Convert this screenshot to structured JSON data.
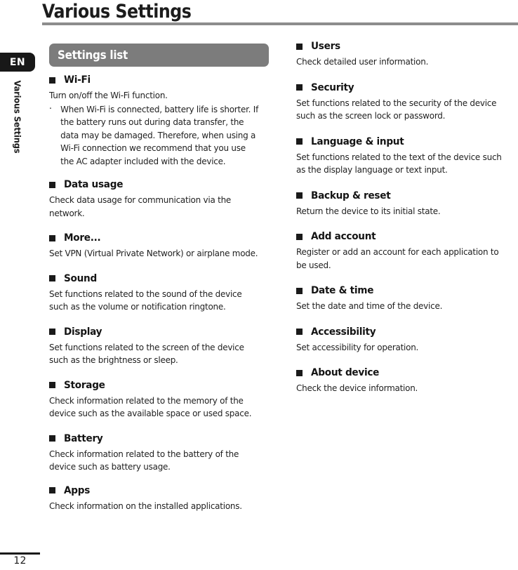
{
  "page": {
    "title": "Various Settings",
    "number": "12",
    "language_tab": "EN",
    "vertical_label": "Various Settings"
  },
  "banner": {
    "label": "Settings list"
  },
  "left_column": [
    {
      "title": "Wi-Fi",
      "body": "Turn on/off the Wi-Fi function.",
      "notes": [
        {
          "dot": "·",
          "text": "When Wi-Fi is connected, battery life is shorter. If the battery runs out during data transfer, the data may be damaged. Therefore, when using a Wi-Fi connection we recommend that you use the AC adapter included with the device."
        }
      ]
    },
    {
      "title": "Data usage",
      "body": "Check data usage for communication via the network."
    },
    {
      "title": "More...",
      "body": "Set VPN (Virtual Private Network) or airplane mode."
    },
    {
      "title": "Sound",
      "body": "Set functions related to the sound of the device such as the volume or notification ringtone."
    },
    {
      "title": "Display",
      "body": "Set functions related to the screen of the device such as the brightness or sleep."
    },
    {
      "title": "Storage",
      "body": "Check information related to the memory of the device such as the available space or used space."
    },
    {
      "title": "Battery",
      "body": "Check information related to the battery of the device such as battery usage."
    },
    {
      "title": "Apps",
      "body": "Check information on the installed applications."
    }
  ],
  "right_column": [
    {
      "title": "Users",
      "body": "Check detailed user information."
    },
    {
      "title": "Security",
      "body": "Set functions related to the security of the device such as the screen lock or password."
    },
    {
      "title": "Language & input",
      "body": "Set functions related to the text of the device such as the display language or text input."
    },
    {
      "title": "Backup & reset",
      "body": "Return the device to its initial state."
    },
    {
      "title": "Add account",
      "body": "Register or add an account for each application to be used."
    },
    {
      "title": "Date & time",
      "body": "Set the date and time of the device."
    },
    {
      "title": "Accessibility",
      "body": "Set accessibility for operation."
    },
    {
      "title": "About device",
      "body": "Check the device information."
    }
  ],
  "colors": {
    "banner_bg": "#7c7c7c",
    "title_rule": "#8d8d8d",
    "tab_bg": "#181818",
    "text": "#1a1a1a"
  }
}
